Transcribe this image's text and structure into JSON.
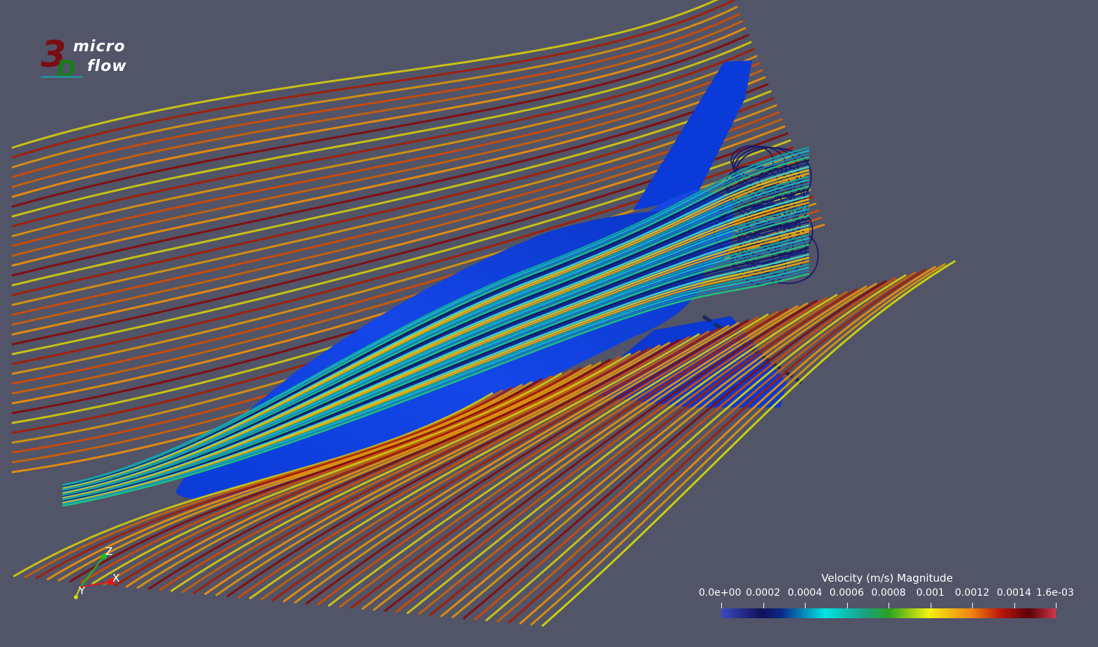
{
  "logo": {
    "digit": "3",
    "letter": "D",
    "word_top": "micro",
    "word_bottom": "flow",
    "colors": {
      "three": "#7a0c14",
      "d": "#1a7a1a",
      "words": "#ffffff"
    }
  },
  "axes": {
    "x_label": "X",
    "y_label": "Y",
    "z_label": "Z",
    "colors": {
      "x": "#e01818",
      "y": "#d8d818",
      "z": "#18c018"
    }
  },
  "legend": {
    "title": "Velocity (m/s) Magnitude",
    "ticks": [
      "0.0e+00",
      "0.0002",
      "0.0004",
      "0.0006",
      "0.0008",
      "0.001",
      "0.0012",
      "0.0014",
      "1.6e-03"
    ],
    "colormap": [
      "#3b4cc0",
      "#101058",
      "#00e4e4",
      "#2aa020",
      "#f2f210",
      "#f08010",
      "#c01a0a",
      "#5a000a",
      "#d03848"
    ]
  },
  "scene": {
    "background": "#525468",
    "body_color": "#0a3ad8",
    "objects": [
      "vehicle-body",
      "fin",
      "engine-nozzle",
      "wing",
      "streamlines"
    ]
  }
}
